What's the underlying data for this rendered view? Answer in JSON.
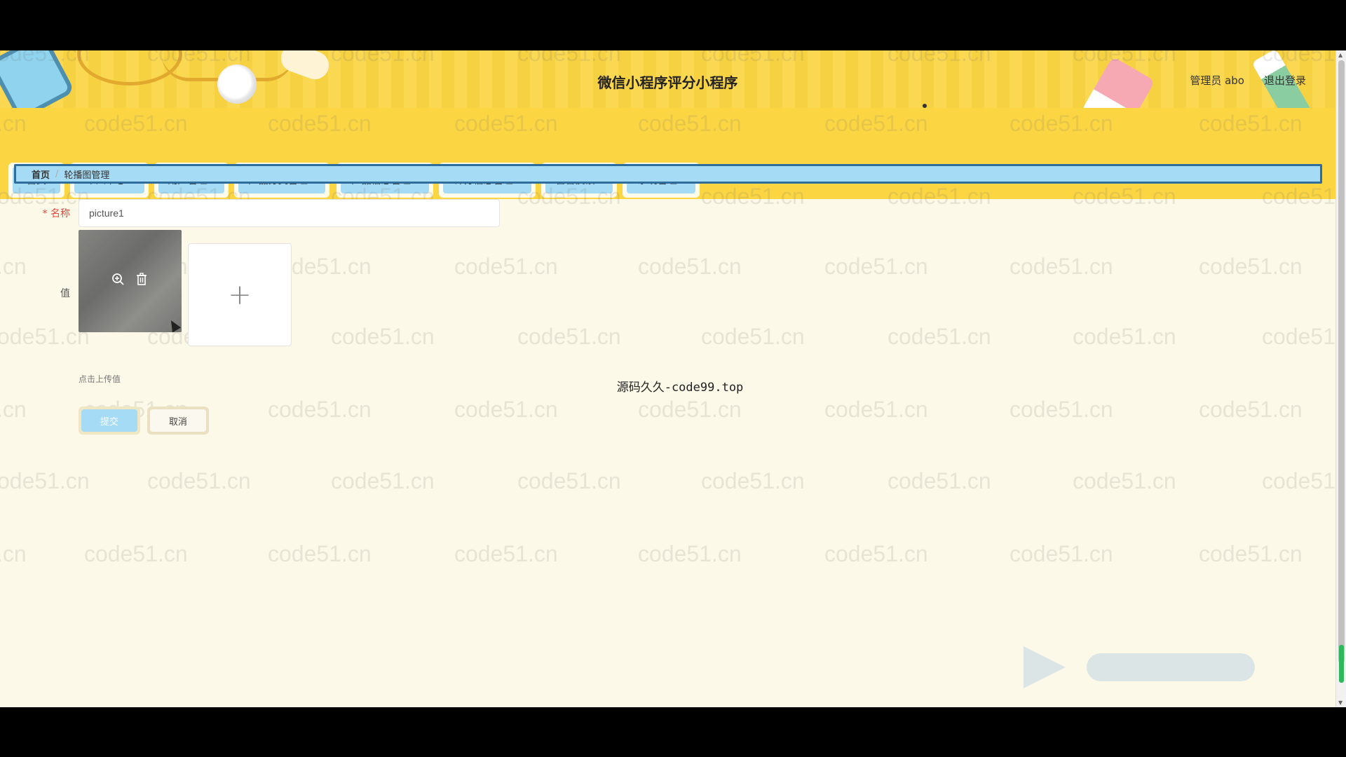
{
  "header": {
    "app_title": "微信小程序评分小程序",
    "user_label": "管理员 abo",
    "logout_label": "退出登录"
  },
  "nav": {
    "items": [
      {
        "label": "首页",
        "has_dropdown": false
      },
      {
        "label": "个人中心",
        "has_dropdown": true
      },
      {
        "label": "用户管理",
        "has_dropdown": true
      },
      {
        "label": "产品分类管理",
        "has_dropdown": true
      },
      {
        "label": "产品信息管理",
        "has_dropdown": true
      },
      {
        "label": "评分信息管理",
        "has_dropdown": true
      },
      {
        "label": "留言反馈",
        "has_dropdown": true
      },
      {
        "label": "系统管理",
        "has_dropdown": true
      }
    ]
  },
  "breadcrumb": {
    "home": "首页",
    "separator": "/",
    "current": "轮播图管理"
  },
  "form": {
    "name_label": "名称",
    "required_mark": "*",
    "name_value": "picture1",
    "value_label": "值",
    "upload_plus": "+",
    "upload_hint": "点击上传值",
    "preview_icon": "zoom-in-icon",
    "delete_icon": "trash-icon"
  },
  "actions": {
    "submit_label": "提交",
    "cancel_label": "取消"
  },
  "watermark": {
    "text": "code51.cn",
    "center_text": "源码久久-code99.top"
  },
  "colors": {
    "header_bg": "#fbd542",
    "nav_button_bg": "#a5dbf4",
    "page_bg": "#fdf9e8",
    "breadcrumb_border": "#2f6e9c"
  }
}
